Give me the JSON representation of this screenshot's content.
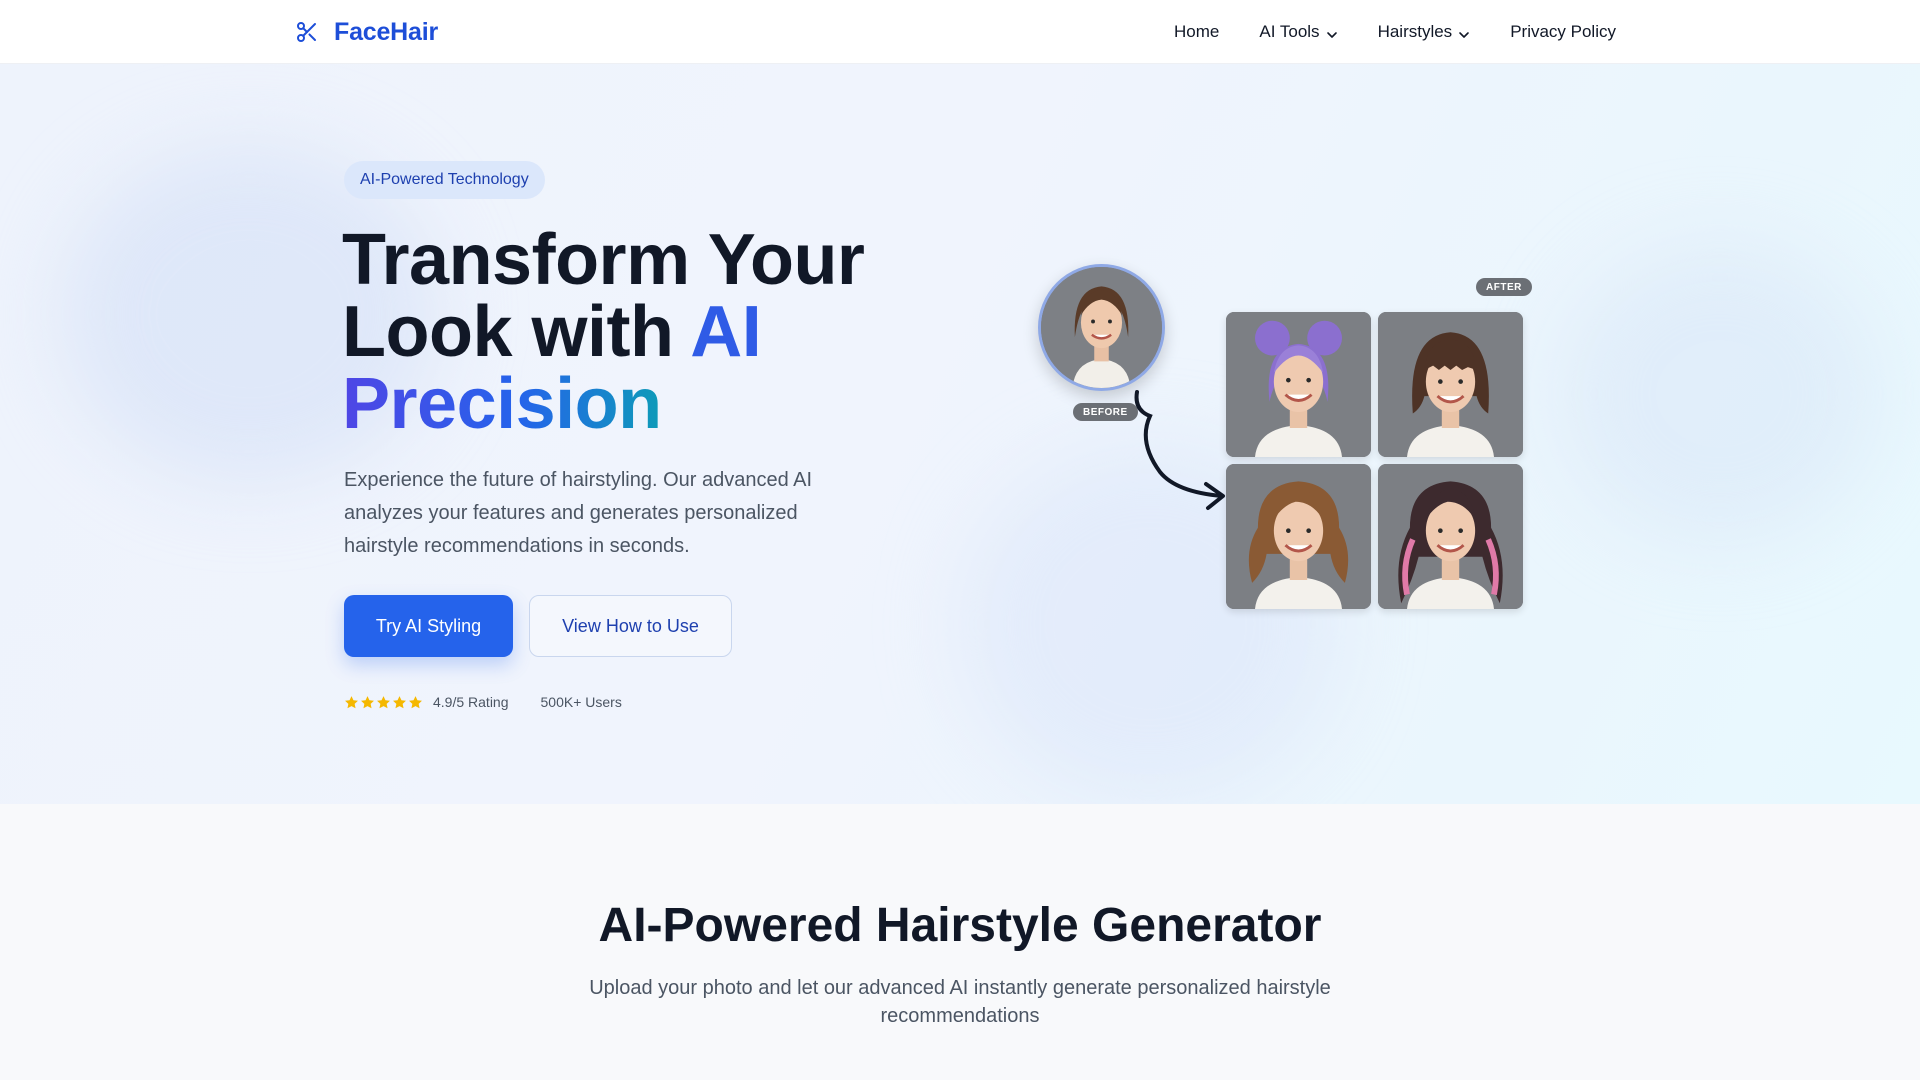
{
  "nav": {
    "brand": "FaceHair",
    "items": [
      {
        "label": "Home",
        "dropdown": false
      },
      {
        "label": "AI Tools",
        "dropdown": true
      },
      {
        "label": "Hairstyles",
        "dropdown": true
      },
      {
        "label": "Privacy Policy",
        "dropdown": false
      }
    ]
  },
  "hero": {
    "badge": "AI-Powered Technology",
    "headline_line1": "Transform Your",
    "headline_line2": "Look with ",
    "headline_accent": "AI",
    "headline_gradient": "Precision",
    "lead": "Experience the future of hairstyling. Our advanced AI analyzes your features and generates personalized hairstyle recommendations in seconds.",
    "primary_button": "Try AI Styling",
    "secondary_button": "View How to Use",
    "rating_stars": 5,
    "rating_text": "4.9/5 Rating",
    "users_text": "500K+ Users",
    "before_label": "BEFORE",
    "after_label": "AFTER",
    "styles": [
      {
        "hair": "purple-space-buns"
      },
      {
        "hair": "brown-bob-bangs"
      },
      {
        "hair": "auburn-waves"
      },
      {
        "hair": "pink-highlight-curls"
      }
    ]
  },
  "colors": {
    "brand": "#1d4ed8",
    "primary": "#2563eb",
    "accent_gradient_start": "#4f46e5",
    "accent_gradient_end": "#0e9bb8",
    "star": "#f5b800"
  },
  "section2": {
    "title": "AI-Powered Hairstyle Generator",
    "subtitle": "Upload your photo and let our advanced AI instantly generate personalized hairstyle recommendations"
  }
}
